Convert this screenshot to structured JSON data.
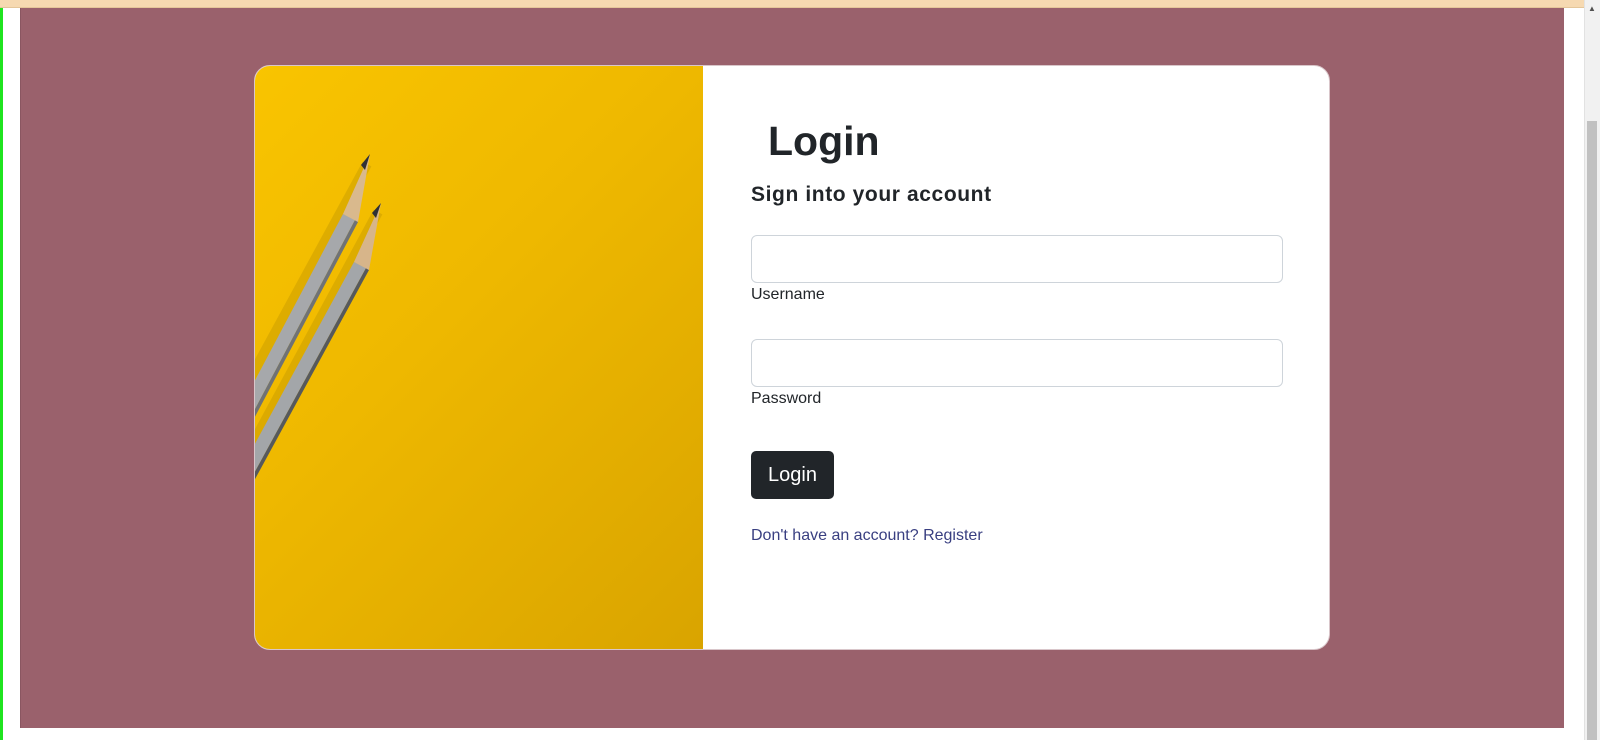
{
  "login": {
    "title": "Login",
    "subtitle": "Sign into your account",
    "username": {
      "label": "Username",
      "value": ""
    },
    "password": {
      "label": "Password",
      "value": ""
    },
    "submit_label": "Login",
    "register_prompt": "Don't have an account? Register"
  },
  "decor": {
    "image_icon": "pencils-illustration",
    "scroll_up_icon": "scroll-up-arrow-icon"
  },
  "colors": {
    "page_background": "#9a616c",
    "button": "#212529",
    "link": "#393f81",
    "image_yellow": "#f9c400"
  }
}
